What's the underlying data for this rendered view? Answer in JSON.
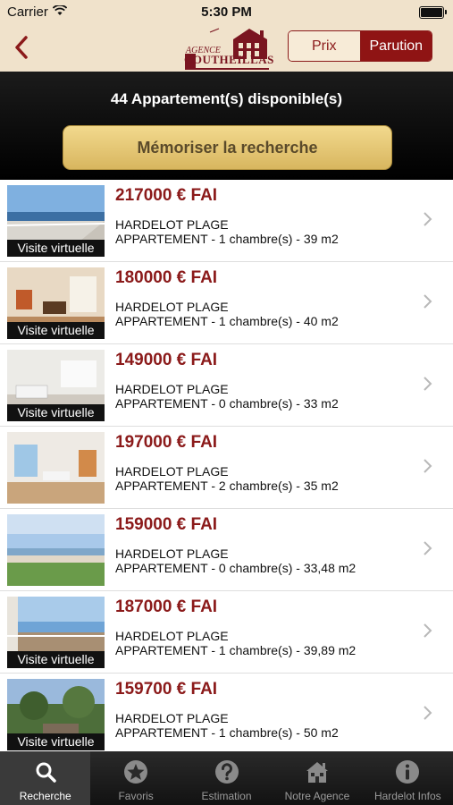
{
  "status_bar": {
    "carrier": "Carrier",
    "time": "5:30 PM"
  },
  "nav": {
    "logo_text_small": "AGENCE",
    "logo_text_main": "COUTHEILLAS",
    "sort_options": [
      "Prix",
      "Parution"
    ],
    "selected_sort": "Parution"
  },
  "header": {
    "count_text": "44 Appartement(s) disponible(s)",
    "memorize_label": "Mémoriser la recherche"
  },
  "listings": [
    {
      "price": "217000 € FAI",
      "location": "HARDELOT PLAGE",
      "details": "APPARTEMENT - 1 chambre(s) - 39 m2",
      "badge": "Visite virtuelle"
    },
    {
      "price": "180000 € FAI",
      "location": "HARDELOT PLAGE",
      "details": "APPARTEMENT - 1 chambre(s) - 40 m2",
      "badge": "Visite virtuelle"
    },
    {
      "price": "149000 € FAI",
      "location": "HARDELOT PLAGE",
      "details": "APPARTEMENT - 0 chambre(s) - 33 m2",
      "badge": "Visite virtuelle"
    },
    {
      "price": "197000 € FAI",
      "location": "HARDELOT PLAGE",
      "details": "APPARTEMENT - 2 chambre(s) - 35 m2",
      "badge": ""
    },
    {
      "price": "159000 € FAI",
      "location": "HARDELOT PLAGE",
      "details": "APPARTEMENT - 0 chambre(s) - 33,48 m2",
      "badge": ""
    },
    {
      "price": "187000 € FAI",
      "location": "HARDELOT PLAGE",
      "details": "APPARTEMENT - 1 chambre(s) - 39,89 m2",
      "badge": "Visite virtuelle"
    },
    {
      "price": "159700 € FAI",
      "location": "HARDELOT PLAGE",
      "details": "APPARTEMENT - 1 chambre(s) - 50 m2",
      "badge": "Visite virtuelle"
    }
  ],
  "tabs": [
    {
      "label": "Recherche",
      "icon": "search-icon"
    },
    {
      "label": "Favoris",
      "icon": "star-icon"
    },
    {
      "label": "Estimation",
      "icon": "question-icon"
    },
    {
      "label": "Notre Agence",
      "icon": "house-icon"
    },
    {
      "label": "Hardelot Infos",
      "icon": "info-icon"
    }
  ],
  "active_tab": "Recherche",
  "colors": {
    "accent": "#8b1a1a",
    "nav_bg": "#f0e2cb",
    "button_gold": "#e6c877"
  }
}
